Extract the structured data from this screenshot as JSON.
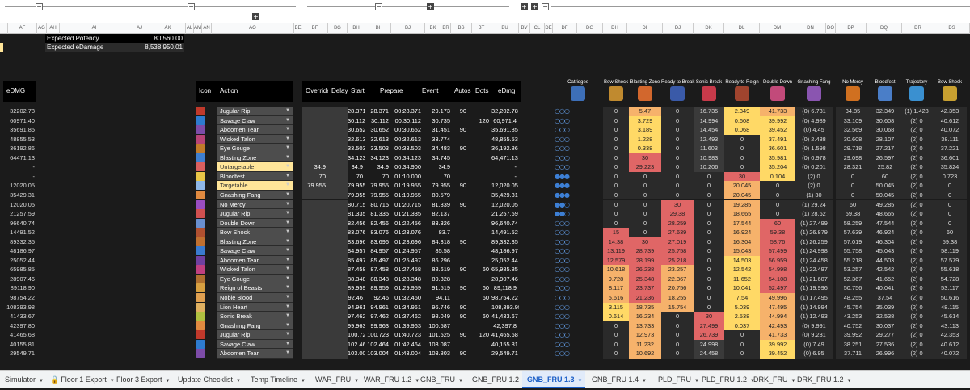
{
  "sheet_summary": {
    "potency_label": "Expected Potency",
    "potency_value": "80,560.00",
    "edamage_label": "Expected eDamage",
    "edamage_value": "8,538,950.01"
  },
  "column_letters": [
    "AF",
    "AG",
    "AH",
    "AI",
    "AJ",
    "AK",
    "AL",
    "AM",
    "AN",
    "AO",
    "BE",
    "BF",
    "BG",
    "BH",
    "BI",
    "BJ",
    "BK",
    "BR",
    "BS",
    "BT",
    "BU",
    "BV",
    "CL",
    "DE",
    "DF",
    "DG",
    "DH",
    "DI",
    "DJ",
    "DK",
    "DL",
    "DM",
    "DN",
    "DO",
    "DP",
    "DQ",
    "DR",
    "DS"
  ],
  "headers": {
    "edmg": "eDMG",
    "icon": "Icon",
    "action": "Action",
    "override": "Override",
    "delay": "Delay",
    "start": "Start",
    "prepare": "Prepare",
    "event": "Event",
    "autos": "Autos",
    "dots": "Dots",
    "edmg2": "eDmg"
  },
  "cooldown_headers": [
    "Catridges",
    "Bow Shock",
    "Blasting Zone",
    "Ready to Break",
    "Sonic Break",
    "Ready to Reign",
    "Double Down",
    "Gnashing Fang",
    "No Mercy",
    "Bloodfest",
    "Trajectory",
    "Bow Shock"
  ],
  "partial_top_row": {
    "action": "Gnashing Fang"
  },
  "rows": [
    {
      "left": "32202.78",
      "action": "Jugular Rip",
      "override": "",
      "delay": "",
      "s1": "28.371",
      "s2": "28.371",
      "prep": "00:28.371",
      "event": "29.173",
      "autos": "90",
      "dots": "",
      "edmg": "32,202.78",
      "cart": "○○○",
      "c2": "0",
      "c3": "5.47",
      "c4": "0",
      "c5": "16.735",
      "c6": "2.349",
      "c7": "41.733",
      "c8": "(0) 6.731",
      "c9": "34.85",
      "c10": "32.349",
      "c11": "(1) 1.428",
      "c12": "42.353"
    },
    {
      "left": "60971.40",
      "action": "Savage Claw",
      "override": "",
      "delay": "",
      "s1": "30.112",
      "s2": "30.112",
      "prep": "00:30.112",
      "event": "30.735",
      "autos": "",
      "dots": "120",
      "edmg": "60,971.4",
      "cart": "○○○",
      "c2": "0",
      "c3": "3.729",
      "c4": "0",
      "c5": "14.994",
      "c6": "0.608",
      "c7": "39.992",
      "c8": "(0) 4.989",
      "c9": "33.109",
      "c10": "30.608",
      "c11": "(2) 0",
      "c12": "40.612"
    },
    {
      "left": "35691.85",
      "action": "Abdomen Tear",
      "override": "",
      "delay": "",
      "s1": "30.652",
      "s2": "30.652",
      "prep": "00:30.652",
      "event": "31.451",
      "autos": "90",
      "dots": "",
      "edmg": "35,691.85",
      "cart": "○○○",
      "c2": "0",
      "c3": "3.189",
      "c4": "0",
      "c5": "14.454",
      "c6": "0.068",
      "c7": "39.452",
      "c8": "(0) 4.45",
      "c9": "32.569",
      "c10": "30.068",
      "c11": "(2) 0",
      "c12": "40.072"
    },
    {
      "left": "48855.53",
      "action": "Wicked Talon",
      "override": "",
      "delay": "",
      "s1": "32.613",
      "s2": "32.613",
      "prep": "00:32.613",
      "event": "33.774",
      "autos": "",
      "dots": "",
      "edmg": "48,855.53",
      "cart": "○○○",
      "c2": "0",
      "c3": "1.228",
      "c4": "0",
      "c5": "12.493",
      "c6": "0",
      "c7": "37.491",
      "c8": "(0) 2.488",
      "c9": "30.608",
      "c10": "28.107",
      "c11": "(2) 0",
      "c12": "38.111"
    },
    {
      "left": "36192.86",
      "action": "Eye Gouge",
      "override": "",
      "delay": "",
      "s1": "33.503",
      "s2": "33.503",
      "prep": "00:33.503",
      "event": "34.483",
      "autos": "90",
      "dots": "",
      "edmg": "36,192.86",
      "cart": "○○○",
      "c2": "0",
      "c3": "0.338",
      "c4": "0",
      "c5": "11.603",
      "c6": "0",
      "c7": "36.601",
      "c8": "(0) 1.598",
      "c9": "29.718",
      "c10": "27.217",
      "c11": "(2) 0",
      "c12": "37.221"
    },
    {
      "left": "64471.13",
      "action": "Blasting Zone",
      "override": "",
      "delay": "",
      "s1": "34.123",
      "s2": "34.123",
      "prep": "00:34.123",
      "event": "34.745",
      "autos": "",
      "dots": "",
      "edmg": "64,471.13",
      "cart": "○○○",
      "c2": "0",
      "c3": "30",
      "c4": "0",
      "c5": "10.983",
      "c6": "0",
      "c7": "35.981",
      "c8": "(0) 0.978",
      "c9": "29.098",
      "c10": "26.597",
      "c11": "(2) 0",
      "c12": "36.601"
    },
    {
      "left": "-",
      "action": "Untargetable",
      "override": "34.9",
      "delay": "",
      "s1": "34.9",
      "s2": "34.9",
      "prep": "00:34.900",
      "event": "34.9",
      "autos": "",
      "dots": "",
      "edmg": "-",
      "cart": "○○○",
      "c2": "0",
      "c3": "29.223",
      "c4": "0",
      "c5": "10.206",
      "c6": "0",
      "c7": "35.204",
      "c8": "(0) 0.201",
      "c9": "28.321",
      "c10": "25.82",
      "c11": "(2) 0",
      "c12": "35.824"
    },
    {
      "left": "-",
      "action": "Bloodfest",
      "override": "70",
      "delay": "",
      "s1": "70",
      "s2": "70",
      "prep": "01:10.000",
      "event": "70",
      "autos": "",
      "dots": "",
      "edmg": "-",
      "cart": "●●●",
      "c2": "0",
      "c3": "0",
      "c4": "0",
      "c5": "0",
      "c6": "30",
      "c7": "0.104",
      "c8": "(2) 0",
      "c9": "0",
      "c10": "60",
      "c11": "(2) 0",
      "c12": "0.723"
    },
    {
      "left": "12020.05",
      "action": "Targetable",
      "override": "79.955",
      "delay": "",
      "s1": "79.955",
      "s2": "79.955",
      "prep": "01:19.955",
      "event": "79.955",
      "autos": "90",
      "dots": "",
      "edmg": "12,020.05",
      "cart": "●●●",
      "c2": "0",
      "c3": "0",
      "c4": "0",
      "c5": "0",
      "c6": "20.045",
      "c7": "0",
      "c8": "(2) 0",
      "c9": "0",
      "c10": "50.045",
      "c11": "(2) 0",
      "c12": "0"
    },
    {
      "left": "35429.31",
      "action": "Gnashing Fang",
      "override": "",
      "delay": "",
      "s1": "79.955",
      "s2": "79.955",
      "prep": "01:19.955",
      "event": "80.579",
      "autos": "",
      "dots": "",
      "edmg": "35,429.31",
      "cart": "●●●",
      "c2": "0",
      "c3": "0",
      "c4": "0",
      "c5": "0",
      "c6": "20.045",
      "c7": "0",
      "c8": "(1) 30",
      "c9": "0",
      "c10": "50.045",
      "c11": "(2) 0",
      "c12": "0"
    },
    {
      "left": "12020.05",
      "action": "No Mercy",
      "override": "",
      "delay": "",
      "s1": "80.715",
      "s2": "80.715",
      "prep": "01:20.715",
      "event": "81.339",
      "autos": "90",
      "dots": "",
      "edmg": "12,020.05",
      "cart": "●●○",
      "c2": "0",
      "c3": "0",
      "c4": "30",
      "c5": "0",
      "c6": "19.285",
      "c7": "0",
      "c8": "(1) 29.24",
      "c9": "60",
      "c10": "49.285",
      "c11": "(2) 0",
      "c12": "0"
    },
    {
      "left": "21257.59",
      "action": "Jugular Rip",
      "override": "",
      "delay": "",
      "s1": "81.335",
      "s2": "81.335",
      "prep": "01:21.335",
      "event": "82.137",
      "autos": "",
      "dots": "",
      "edmg": "21,257.59",
      "cart": "●●○",
      "c2": "0",
      "c3": "0",
      "c4": "29.38",
      "c5": "0",
      "c6": "18.665",
      "c7": "0",
      "c8": "(1) 28.62",
      "c9": "59.38",
      "c10": "48.665",
      "c11": "(2) 0",
      "c12": "0"
    },
    {
      "left": "96640.74",
      "action": "Double Down",
      "override": "",
      "delay": "",
      "s1": "82.456",
      "s2": "82.456",
      "prep": "01:22.456",
      "event": "83.326",
      "autos": "",
      "dots": "",
      "edmg": "96,640.74",
      "cart": "○○○",
      "c2": "0",
      "c3": "0",
      "c4": "28.259",
      "c5": "0",
      "c6": "17.544",
      "c7": "60",
      "c8": "(1) 27.499",
      "c9": "58.259",
      "c10": "47.544",
      "c11": "(2) 0",
      "c12": "0"
    },
    {
      "left": "14491.52",
      "action": "Bow Shock",
      "override": "",
      "delay": "",
      "s1": "83.076",
      "s2": "83.076",
      "prep": "01:23.076",
      "event": "83.7",
      "autos": "",
      "dots": "",
      "edmg": "14,491.52",
      "cart": "○○○",
      "c2": "15",
      "c3": "0",
      "c4": "27.639",
      "c5": "0",
      "c6": "16.924",
      "c7": "59.38",
      "c8": "(1) 26.879",
      "c9": "57.639",
      "c10": "46.924",
      "c11": "(2) 0",
      "c12": "60"
    },
    {
      "left": "89332.35",
      "action": "Blasting Zone",
      "override": "",
      "delay": "",
      "s1": "83.696",
      "s2": "83.696",
      "prep": "01:23.696",
      "event": "84.318",
      "autos": "90",
      "dots": "",
      "edmg": "89,332.35",
      "cart": "○○○",
      "c2": "14.38",
      "c3": "30",
      "c4": "27.019",
      "c5": "0",
      "c6": "16.304",
      "c7": "58.76",
      "c8": "(1) 26.259",
      "c9": "57.019",
      "c10": "46.304",
      "c11": "(2) 0",
      "c12": "59.38"
    },
    {
      "left": "48186.97",
      "action": "Savage Claw",
      "override": "",
      "delay": "",
      "s1": "84.957",
      "s2": "84.957",
      "prep": "01:24.957",
      "event": "85.58",
      "autos": "",
      "dots": "",
      "edmg": "48,186.97",
      "cart": "○○○",
      "c2": "13.119",
      "c3": "28.739",
      "c4": "25.758",
      "c5": "0",
      "c6": "15.043",
      "c7": "57.499",
      "c8": "(1) 24.998",
      "c9": "55.758",
      "c10": "45.043",
      "c11": "(2) 0",
      "c12": "58.119"
    },
    {
      "left": "25052.44",
      "action": "Abdomen Tear",
      "override": "",
      "delay": "",
      "s1": "85.497",
      "s2": "85.497",
      "prep": "01:25.497",
      "event": "86.296",
      "autos": "",
      "dots": "",
      "edmg": "25,052.44",
      "cart": "○○○",
      "c2": "12.579",
      "c3": "28.199",
      "c4": "25.218",
      "c5": "0",
      "c6": "14.503",
      "c7": "56.959",
      "c8": "(1) 24.458",
      "c9": "55.218",
      "c10": "44.503",
      "c11": "(2) 0",
      "c12": "57.579"
    },
    {
      "left": "65985.85",
      "action": "Wicked Talon",
      "override": "",
      "delay": "",
      "s1": "87.458",
      "s2": "87.458",
      "prep": "01:27.458",
      "event": "88.619",
      "autos": "90",
      "dots": "60",
      "edmg": "65,985.85",
      "cart": "○○○",
      "c2": "10.618",
      "c3": "26.238",
      "c4": "23.257",
      "c5": "0",
      "c6": "12.542",
      "c7": "54.998",
      "c8": "(1) 22.497",
      "c9": "53.257",
      "c10": "42.542",
      "c11": "(2) 0",
      "c12": "55.618"
    },
    {
      "left": "28907.46",
      "action": "Eye Gouge",
      "override": "",
      "delay": "",
      "s1": "88.348",
      "s2": "88.348",
      "prep": "01:28.348",
      "event": "89.328",
      "autos": "",
      "dots": "",
      "edmg": "28,907.46",
      "cart": "○○○",
      "c2": "9.728",
      "c3": "25.348",
      "c4": "22.367",
      "c5": "0",
      "c6": "11.652",
      "c7": "54.108",
      "c8": "(1) 21.607",
      "c9": "52.367",
      "c10": "41.652",
      "c11": "(2) 0",
      "c12": "54.728"
    },
    {
      "left": "89118.90",
      "action": "Reign of Beasts",
      "override": "",
      "delay": "",
      "s1": "89.959",
      "s2": "89.959",
      "prep": "01:29.959",
      "event": "91.519",
      "autos": "90",
      "dots": "60",
      "edmg": "89,118.9",
      "cart": "○○○",
      "c2": "8.117",
      "c3": "23.737",
      "c4": "20.756",
      "c5": "0",
      "c6": "10.041",
      "c7": "52.497",
      "c8": "(1) 19.996",
      "c9": "50.756",
      "c10": "40.041",
      "c11": "(2) 0",
      "c12": "53.117"
    },
    {
      "left": "98754.22",
      "action": "Noble Blood",
      "override": "",
      "delay": "",
      "s1": "92.46",
      "s2": "92.46",
      "prep": "01:32.460",
      "event": "94.11",
      "autos": "",
      "dots": "60",
      "edmg": "98,754.22",
      "cart": "○○○",
      "c2": "5.616",
      "c3": "21.236",
      "c4": "18.255",
      "c5": "0",
      "c6": "7.54",
      "c7": "49.996",
      "c8": "(1) 17.495",
      "c9": "48.255",
      "c10": "37.54",
      "c11": "(2) 0",
      "c12": "50.616"
    },
    {
      "left": "108393.98",
      "action": "Lion Heart",
      "override": "",
      "delay": "",
      "s1": "94.961",
      "s2": "94.961",
      "prep": "01:34.961",
      "event": "96.746",
      "autos": "90",
      "dots": "",
      "edmg": "108,393.98",
      "cart": "○○○",
      "c2": "3.115",
      "c3": "18.735",
      "c4": "15.754",
      "c5": "0",
      "c6": "5.039",
      "c7": "47.495",
      "c8": "(1) 14.994",
      "c9": "45.754",
      "c10": "35.039",
      "c11": "(2) 0",
      "c12": "48.115"
    },
    {
      "left": "41433.67",
      "action": "Sonic Break",
      "override": "",
      "delay": "",
      "s1": "97.462",
      "s2": "97.462",
      "prep": "01:37.462",
      "event": "98.049",
      "autos": "90",
      "dots": "60",
      "edmg": "41,433.67",
      "cart": "○○○",
      "c2": "0.614",
      "c3": "16.234",
      "c4": "0",
      "c5": "30",
      "c6": "2.538",
      "c7": "44.994",
      "c8": "(1) 12.493",
      "c9": "43.253",
      "c10": "32.538",
      "c11": "(2) 0",
      "c12": "45.614"
    },
    {
      "left": "42397.80",
      "action": "Gnashing Fang",
      "override": "",
      "delay": "",
      "s1": "99.963",
      "s2": "99.963",
      "prep": "01:39.963",
      "event": "100.587",
      "autos": "",
      "dots": "",
      "edmg": "42,397.8",
      "cart": "○○○",
      "c2": "0",
      "c3": "13.733",
      "c4": "0",
      "c5": "27.499",
      "c6": "0.037",
      "c7": "42.493",
      "c8": "(0) 9.991",
      "c9": "40.752",
      "c10": "30.037",
      "c11": "(2) 0",
      "c12": "43.113"
    },
    {
      "left": "41465.68",
      "action": "Jugular Rip",
      "override": "",
      "delay": "",
      "s1": "100.723",
      "s2": "100.723",
      "prep": "01:40.723",
      "event": "101.525",
      "autos": "90",
      "dots": "120",
      "edmg": "41,465.68",
      "cart": "○○○",
      "c2": "0",
      "c3": "12.973",
      "c4": "0",
      "c5": "26.739",
      "c6": "0",
      "c7": "41.733",
      "c8": "(0) 9.231",
      "c9": "39.992",
      "c10": "29.277",
      "c11": "(2) 0",
      "c12": "42.353"
    },
    {
      "left": "40155.81",
      "action": "Savage Claw",
      "override": "",
      "delay": "",
      "s1": "102.464",
      "s2": "102.464",
      "prep": "01:42.464",
      "event": "103.087",
      "autos": "",
      "dots": "",
      "edmg": "40,155.81",
      "cart": "○○○",
      "c2": "0",
      "c3": "11.232",
      "c4": "0",
      "c5": "24.998",
      "c6": "0",
      "c7": "39.992",
      "c8": "(0) 7.49",
      "c9": "38.251",
      "c10": "27.536",
      "c11": "(2) 0",
      "c12": "40.612"
    },
    {
      "left": "29549.71",
      "action": "Abdomen Tear",
      "override": "",
      "delay": "",
      "s1": "103.004",
      "s2": "103.004",
      "prep": "01:43.004",
      "event": "103.803",
      "autos": "90",
      "dots": "",
      "edmg": "29,549.71",
      "cart": "○○○",
      "c2": "0",
      "c3": "10.692",
      "c4": "0",
      "c5": "24.458",
      "c6": "0",
      "c7": "39.452",
      "c8": "(0) 6.95",
      "c9": "37.711",
      "c10": "26.996",
      "c11": "(2) 0",
      "c12": "40.072"
    }
  ],
  "tabs": [
    "Simulator",
    "Floor 1 Export",
    "Floor 3 Export",
    "Update Checklist",
    "Temp Timeline",
    "WAR_FRU",
    "WAR_FRU 1.2",
    "GNB_FRU",
    "GNB_FRU 1.2",
    "GNB_FRU 1.3",
    "GNB_FRU 1.4",
    "PLD_FRU",
    "PLD_FRU 1.2",
    "DRK_FRU",
    "DRK_FRU 1.2"
  ],
  "active_tab": "GNB_FRU 1.3",
  "colors": {
    "red": "#e06666",
    "orange": "#f6b26b",
    "yellow": "#ffd966",
    "dark": "#3a3a3a",
    "blue_dot": "#3d7fd4",
    "highlight_row": "#ffe599"
  }
}
